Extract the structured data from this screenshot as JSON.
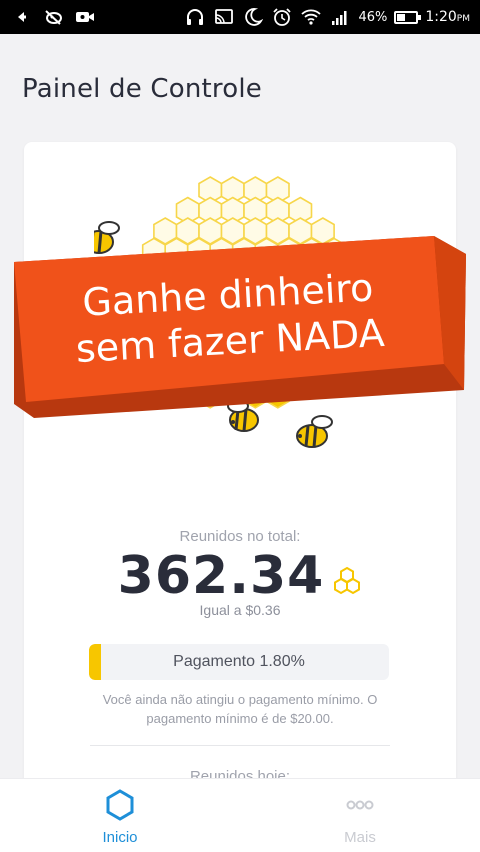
{
  "status_bar": {
    "battery_percent_label": "46%",
    "battery_level": 0.46,
    "time": "1:20",
    "ampm": "PM",
    "icons": [
      "arrow-icon",
      "ghost-icon",
      "video-icon",
      "headphones-icon",
      "cast-icon",
      "moon-icon",
      "alarm-icon",
      "wifi-icon",
      "signal-icon",
      "battery-icon"
    ]
  },
  "header": {
    "title": "Painel de Controle"
  },
  "banner": {
    "line1": "Ganhe dinheiro",
    "line2": "sem fazer NADA",
    "color": "#f0521a"
  },
  "summary": {
    "total_label": "Reunidos no total:",
    "total_value": "362.34",
    "equal_text": "Igual a $0.36",
    "progress_label": "Pagamento 1.80%",
    "progress_fraction": 0.018,
    "note": "Você ainda não atingiu o pagamento mínimo. O pagamento mínimo é de $20.00.",
    "today_label": "Reunidos hoje:"
  },
  "bottom_nav": {
    "items": [
      {
        "label": "Inicio",
        "icon": "hexagon-icon",
        "active": true
      },
      {
        "label": "Mais",
        "icon": "more-icon",
        "active": false
      }
    ]
  },
  "colors": {
    "accent": "#1e8fd8",
    "honey": "#f7c600",
    "banner": "#f0521a",
    "text": "#2a2d3a"
  }
}
